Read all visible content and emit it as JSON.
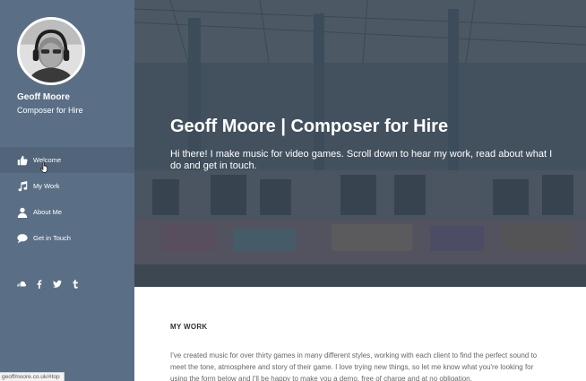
{
  "profile": {
    "name": "Geoff Moore",
    "role": "Composer for Hire"
  },
  "nav": {
    "items": [
      {
        "label": "Welcome",
        "icon": "thumbs-up-icon"
      },
      {
        "label": "My Work",
        "icon": "music-note-icon"
      },
      {
        "label": "About Me",
        "icon": "user-icon"
      },
      {
        "label": "Get in Touch",
        "icon": "speech-bubble-icon"
      }
    ],
    "active_index": 0
  },
  "social": [
    "soundcloud-icon",
    "facebook-icon",
    "twitter-icon",
    "tumblr-icon"
  ],
  "hero": {
    "title": "Geoff Moore | Composer for Hire",
    "subtitle": "Hi there! I make music for video games. Scroll down to hear my work, read about what I do and get in touch."
  },
  "section": {
    "title": "MY WORK",
    "body": "I've created music for over thirty games in many different styles, working with each client to find the perfect sound to meet the tone, atmosphere and story of their game. I love trying new things, so let me know what you're looking for using the form below and I'll be happy to make you a demo, free of charge and at no obligation."
  },
  "status": {
    "url": "geoffmoore.co.uk/#top"
  },
  "colors": {
    "sidebar": "#5a6f86",
    "sidebar_active": "#526479",
    "hero_overlay": "#3e4e60"
  }
}
